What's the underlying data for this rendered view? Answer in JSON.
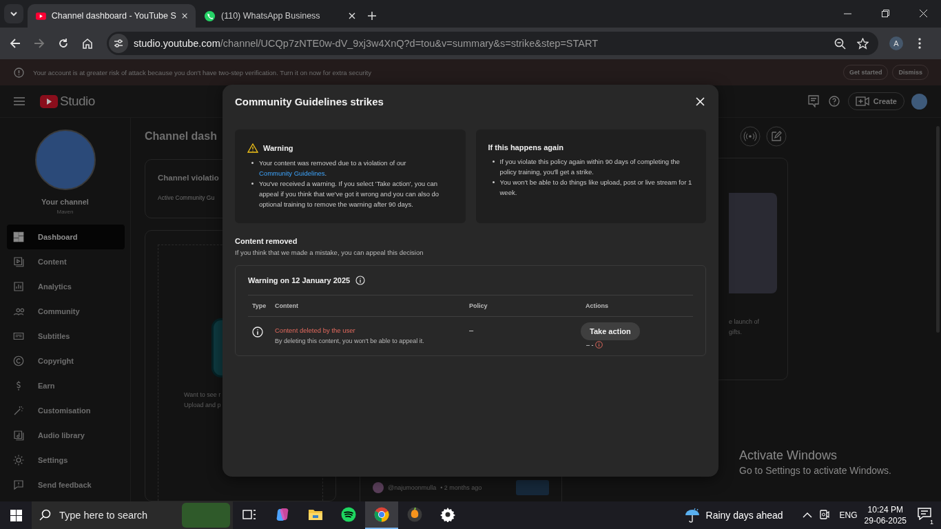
{
  "browser": {
    "tabs": [
      {
        "title": "Channel dashboard - YouTube S",
        "selected": true
      },
      {
        "title": "(110) WhatsApp Business",
        "selected": false
      }
    ],
    "url_host": "studio.youtube.com",
    "url_path": "/channel/UCQp7zNTE0w-dV_9xj3w4XnQ?d=tou&v=summary&s=strike&step=START",
    "profile_initial": "A"
  },
  "security_banner": {
    "message": "Your account is at greater risk of attack because you don't have two-step verification. Turn it on now for extra security",
    "buttons": [
      "Get started",
      "Dismiss"
    ]
  },
  "studio": {
    "logo": "Studio",
    "create_button": "Create",
    "channel": {
      "label": "Your channel",
      "name": "Maven"
    },
    "nav": [
      {
        "label": "Dashboard",
        "selected": true
      },
      {
        "label": "Content",
        "selected": false
      },
      {
        "label": "Analytics",
        "selected": false
      },
      {
        "label": "Community",
        "selected": false
      },
      {
        "label": "Subtitles",
        "selected": false
      },
      {
        "label": "Copyright",
        "selected": false
      },
      {
        "label": "Earn",
        "selected": false
      },
      {
        "label": "Customisation",
        "selected": false
      },
      {
        "label": "Audio library",
        "selected": false
      },
      {
        "label": "Settings",
        "selected": false
      },
      {
        "label": "Send feedback",
        "selected": false
      }
    ],
    "page_title": "Channel dash",
    "violations_card": {
      "title": "Channel violatio",
      "text": "Active Community Gu"
    },
    "upload_card": {
      "lines": [
        "Want to see r",
        "Upload and p"
      ]
    },
    "news_card": {
      "lines": [
        "e launch of",
        "gifts."
      ]
    },
    "comment": {
      "author": "@najumoonmulla",
      "time": "• 2 months ago"
    }
  },
  "dialog": {
    "title": "Community Guidelines strikes",
    "warning_box": {
      "title": "Warning",
      "bullets": [
        {
          "text": "Your content was removed due to a violation of our ",
          "link": "Community Guidelines",
          "after": "."
        },
        {
          "text": "You've received a warning. If you select 'Take action', you can appeal if you think that we've got it wrong and you can also do optional training to remove the warning after 90 days."
        }
      ]
    },
    "again_box": {
      "title": "If this happens again",
      "bullets": [
        {
          "text": "If you violate this policy again within 90 days of completing the policy training, you'll get a strike."
        },
        {
          "text": "You won't be able to do things like upload, post or live stream for 1 week."
        }
      ]
    },
    "section_title": "Content removed",
    "section_text": "If you think that we made a mistake, you can appeal this decision",
    "strike": {
      "title": "Warning on 12 January 2025",
      "columns": [
        "Type",
        "Content",
        "Policy",
        "Actions"
      ],
      "rows": [
        {
          "content_title": "Content deleted by the user",
          "content_note": "By deleting this content, you won't be able to appeal it.",
          "policy": "–",
          "action": "Take action",
          "action_note": "– -"
        }
      ]
    }
  },
  "activation_notice": {
    "title": "Activate Windows",
    "text": "Go to Settings to activate Windows."
  },
  "taskbar": {
    "search_placeholder": "Type here to search",
    "apps": [
      {
        "kind": "task-view",
        "selected": false
      },
      {
        "kind": "copilot",
        "selected": false
      },
      {
        "kind": "files",
        "selected": false
      },
      {
        "kind": "spotify",
        "selected": false
      },
      {
        "kind": "chrome",
        "selected": true
      },
      {
        "kind": "fl-studio",
        "selected": false
      },
      {
        "kind": "settings",
        "selected": false
      }
    ],
    "weather": "Rainy days ahead",
    "language": "ENG",
    "time": "10:24 PM",
    "date": "29-06-2025",
    "notification_count": "1"
  }
}
